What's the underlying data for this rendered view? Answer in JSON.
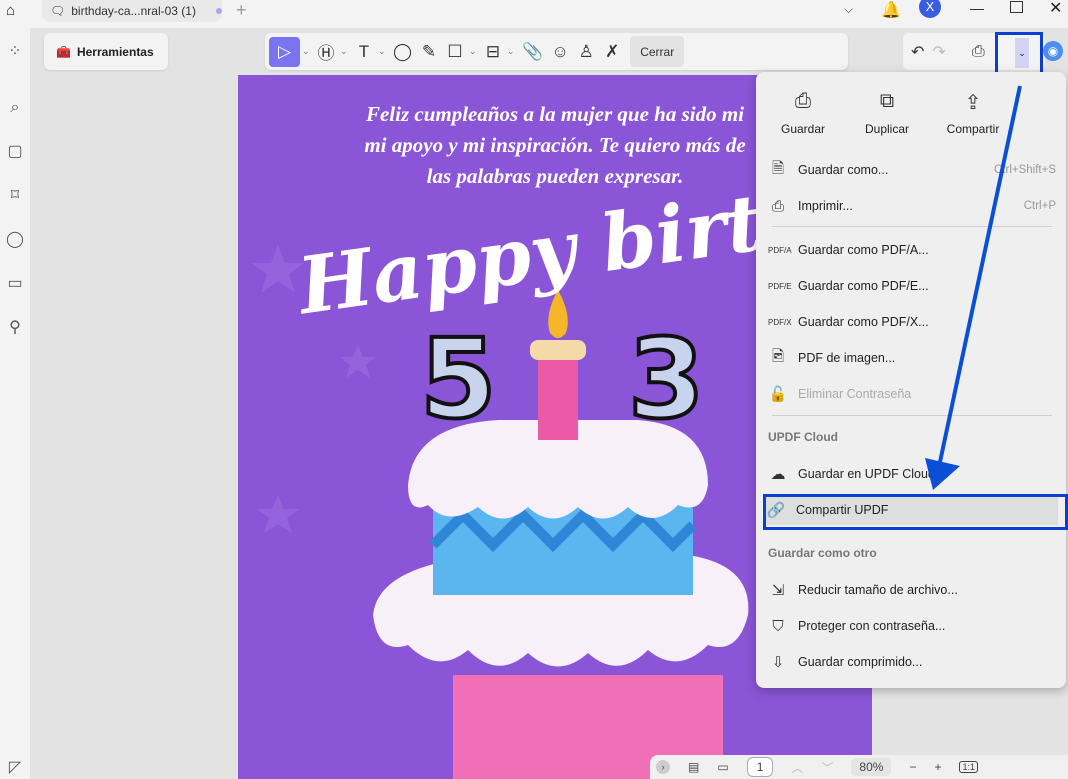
{
  "tab": {
    "title": "birthday-ca...nral-03 (1)"
  },
  "toolbar": {
    "herramientas": "Herramientas",
    "cerrar": "Cerrar"
  },
  "avatar": "X",
  "document": {
    "lines": [
      "Feliz cumpleaños a la mujer que ha sido mi",
      "mi apoyo y mi inspiración. Te quiero más de",
      "las palabras pueden expresar."
    ],
    "headline": "Happy birthday",
    "age_left": "5",
    "age_right": "3"
  },
  "menu": {
    "quick": [
      {
        "label": "Guardar",
        "icon": "save-icon"
      },
      {
        "label": "Duplicar",
        "icon": "duplicate-icon"
      },
      {
        "label": "Compartir",
        "icon": "share-icon"
      }
    ],
    "items": [
      {
        "label": "Guardar como...",
        "shortcut": "Ctrl+Shift+S"
      },
      {
        "label": "Imprimir...",
        "shortcut": "Ctrl+P"
      },
      {
        "label": "Guardar como PDF/A..."
      },
      {
        "label": "Guardar como PDF/E..."
      },
      {
        "label": "Guardar como PDF/X..."
      },
      {
        "label": "PDF de imagen..."
      },
      {
        "label": "Eliminar Contraseña"
      },
      {
        "label": "Guardar en UPDF Cloud"
      },
      {
        "label": "Compartir UPDF"
      },
      {
        "label": "Reducir tamaño de archivo..."
      },
      {
        "label": "Proteger con contraseña..."
      },
      {
        "label": "Guardar comprimido..."
      }
    ],
    "section_cloud": "UPDF Cloud",
    "section_other": "Guardar como otro"
  },
  "bottom": {
    "page": "1",
    "zoom": "80%",
    "fit": "1:1"
  },
  "colors": {
    "accent": "#7a74f0",
    "highlight": "#0a3fd1",
    "page": "#8a55d6"
  }
}
